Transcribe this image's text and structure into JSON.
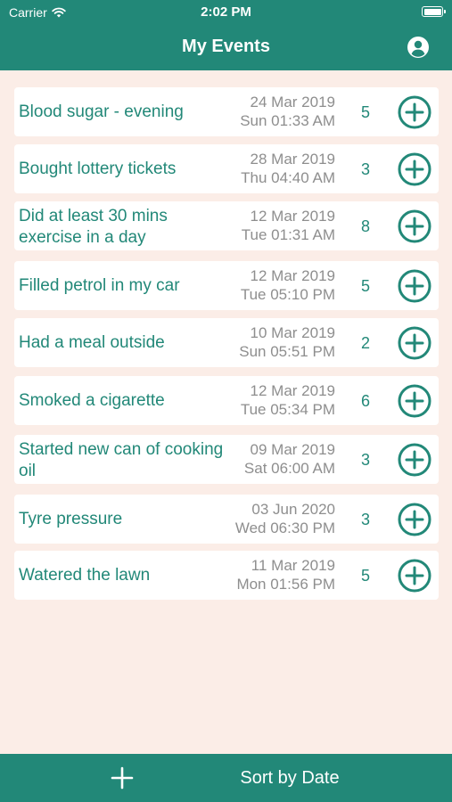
{
  "status_bar": {
    "carrier": "Carrier",
    "time": "2:02 PM"
  },
  "nav": {
    "title": "My Events"
  },
  "colors": {
    "accent": "#228878",
    "background": "#fbede7",
    "date_text": "#8e8e8e"
  },
  "events": [
    {
      "name": "Blood sugar - evening",
      "date": "24 Mar 2019",
      "time": "Sun 01:33 AM",
      "count": "5"
    },
    {
      "name": "Bought lottery tickets",
      "date": "28 Mar 2019",
      "time": "Thu 04:40 AM",
      "count": "3"
    },
    {
      "name": "Did at least 30 mins exercise in a day",
      "date": "12 Mar 2019",
      "time": "Tue 01:31 AM",
      "count": "8"
    },
    {
      "name": "Filled petrol in my car",
      "date": "12 Mar 2019",
      "time": "Tue 05:10 PM",
      "count": "5"
    },
    {
      "name": "Had a meal outside",
      "date": "10 Mar 2019",
      "time": "Sun 05:51 PM",
      "count": "2"
    },
    {
      "name": "Smoked a cigarette",
      "date": "12 Mar 2019",
      "time": "Tue 05:34 PM",
      "count": "6"
    },
    {
      "name": "Started new can of cooking oil",
      "date": "09 Mar 2019",
      "time": "Sat 06:00 AM",
      "count": "3"
    },
    {
      "name": "Tyre pressure",
      "date": "03 Jun 2020",
      "time": "Wed 06:30 PM",
      "count": "3"
    },
    {
      "name": "Watered the lawn",
      "date": "11 Mar 2019",
      "time": "Mon 01:56 PM",
      "count": "5"
    }
  ],
  "toolbar": {
    "sort_label": "Sort by Date"
  },
  "icons": {
    "wifi": "wifi-icon",
    "battery": "battery-icon",
    "profile": "person-circle-icon",
    "row_add": "plus-circle-icon",
    "toolbar_add": "plus-icon"
  }
}
